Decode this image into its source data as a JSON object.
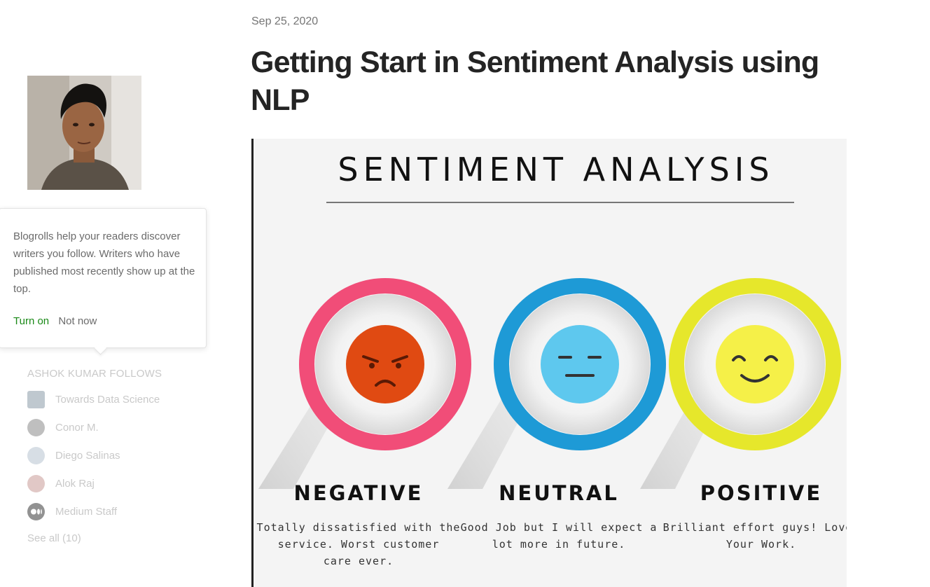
{
  "sidebar": {
    "popover": {
      "text": "Blogrolls help your readers discover writers you follow. Writers who have published most recently show up at the top.",
      "turn_on": "Turn on",
      "not_now": "Not now"
    },
    "follows": {
      "title": "ASHOK KUMAR FOLLOWS",
      "items": [
        {
          "name": "Towards Data Science",
          "icon": "publication-icon"
        },
        {
          "name": "Conor M.",
          "icon": "avatar"
        },
        {
          "name": "Diego Salinas",
          "icon": "avatar"
        },
        {
          "name": "Alok Raj",
          "icon": "avatar"
        },
        {
          "name": "Medium Staff",
          "icon": "medium-logo-icon"
        }
      ],
      "see_all": "See all (10)"
    }
  },
  "article": {
    "date": "Sep 25, 2020",
    "title": "Getting Start in Sentiment Analysis using NLP",
    "hero": {
      "heading": "SENTIMENT ANALYSIS",
      "sections": [
        {
          "label": "NEGATIVE",
          "line1": "Totally dissatisfied with the",
          "line2": "service. Worst customer",
          "line3": "care ever.",
          "ring": "#f14d78",
          "face": "#e04a12"
        },
        {
          "label": "NEUTRAL",
          "line1": "Good Job but I will expect a",
          "line2": "lot more in future.",
          "line3": "",
          "ring": "#1e9ad6",
          "face": "#5ec8ee"
        },
        {
          "label": "POSITIVE",
          "line1": "Brilliant effort guys! Loved",
          "line2": "Your Work.",
          "line3": "",
          "ring": "#e6e72b",
          "face": "#f5f048"
        }
      ]
    }
  }
}
